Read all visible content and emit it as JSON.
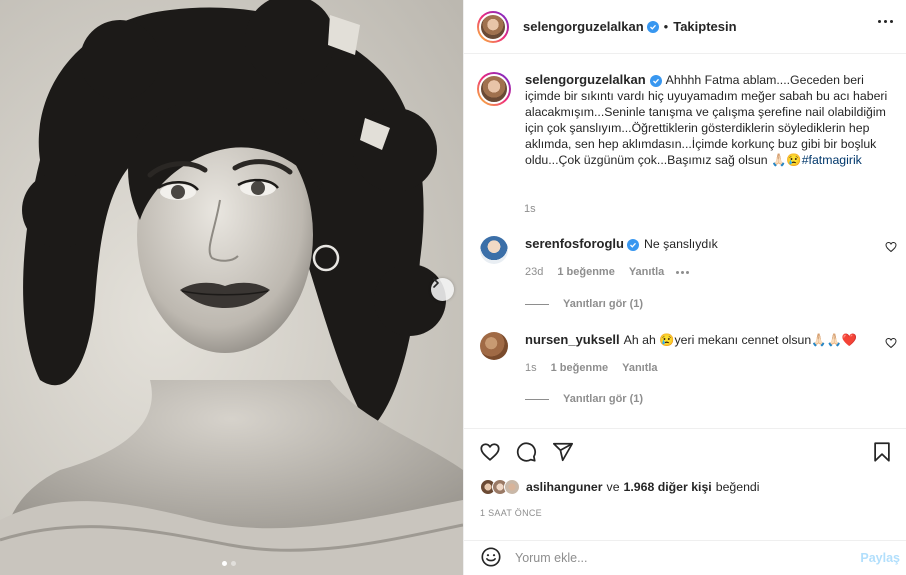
{
  "post": {
    "author": "selengorguzelalkan",
    "separator": "•",
    "follow_status": "Takiptesin",
    "caption_text": "Ahhhh Fatma ablam....Geceden beri içimde bir sıkıntı vardı hiç uyuyamadım meğer sabah bu acı haberi alacakmışım...Seninle tanışma ve çalışma şerefine nail olabildiğim için çok şanslıyım...Öğrettiklerin gösterdiklerin söylediklerin hep aklımda, sen hep aklımdasın...İçimde korkunç buz gibi bir boşluk oldu...Çok üzgünüm çok...Başımız sağ olsun 🙏🏻😢",
    "caption_hashtag": "#fatmagirik",
    "caption_time": "1s"
  },
  "comments": [
    {
      "username": "serenfosforoglu",
      "verified": true,
      "text": "Ne şanslıydık",
      "time": "23d",
      "likes": "1 beğenme",
      "reply_label": "Yanıtla",
      "view_replies": "Yanıtları gör (1)"
    },
    {
      "username": "nursen_yuksell",
      "verified": false,
      "text": "Ah ah 😢yeri mekanı cennet olsun🙏🏻🙏🏻❤️",
      "time": "1s",
      "likes": "1 beğenme",
      "reply_label": "Yanıtla",
      "view_replies": "Yanıtları gör (1)"
    }
  ],
  "likes": {
    "liker": "aslihanguner",
    "connector": "ve",
    "others": "1.968 diğer kişi",
    "suffix": "beğendi"
  },
  "timestamp": "1 SAAT ÖNCE",
  "composer": {
    "placeholder": "Yorum ekle...",
    "post_label": "Paylaş"
  },
  "carousel": {
    "slide_count": 2,
    "active_index": 0
  },
  "colors": {
    "verified_blue": "#3897f0",
    "link_blue": "#00376b",
    "muted_text": "#8e8e8e",
    "post_button_disabled": "#b2dffc"
  },
  "icons": {
    "verified": "verified-badge-icon",
    "more": "more-horizontal-icon",
    "like": "heart-outline-icon",
    "comment": "comment-bubble-icon",
    "share": "paper-plane-icon",
    "save": "bookmark-icon",
    "emoji": "smiley-icon",
    "next": "chevron-right-icon"
  }
}
